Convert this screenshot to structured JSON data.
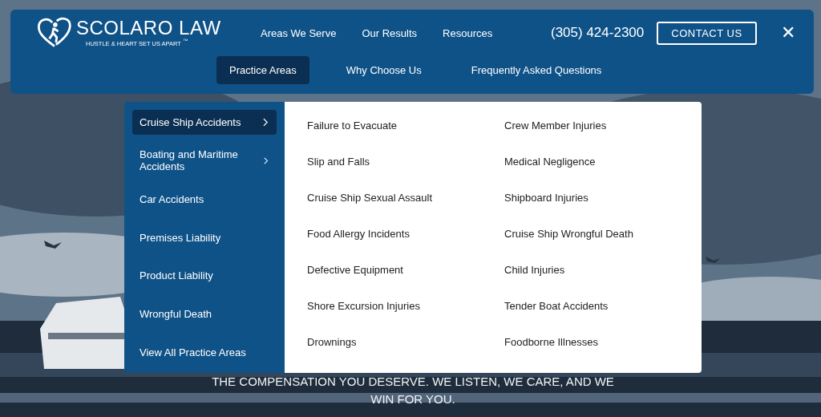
{
  "logo": {
    "name": "SCOLARO LAW",
    "tagline": "HUSTLE & HEART SET US APART $^{™}$"
  },
  "top_nav": [
    {
      "label": "Areas We Serve"
    },
    {
      "label": "Our Results"
    },
    {
      "label": "Resources"
    }
  ],
  "phone": "(305) 424-2300",
  "contact_button": "CONTACT US",
  "close_icon": "✕",
  "main_nav": [
    {
      "label": "Practice Areas",
      "selected": true
    },
    {
      "label": "Why Choose Us",
      "selected": false
    },
    {
      "label": "Frequently Asked Questions",
      "selected": false
    }
  ],
  "practice_categories": [
    {
      "label": "Cruise Ship Accidents",
      "selected": true,
      "has_submenu": true
    },
    {
      "label": "Boating and Maritime Accidents",
      "selected": false,
      "has_submenu": true
    },
    {
      "label": "Car Accidents",
      "selected": false,
      "has_submenu": false
    },
    {
      "label": "Premises Liability",
      "selected": false,
      "has_submenu": false
    },
    {
      "label": "Product Liability",
      "selected": false,
      "has_submenu": false
    },
    {
      "label": "Wrongful Death",
      "selected": false,
      "has_submenu": false
    },
    {
      "label": "View All Practice Areas",
      "selected": false,
      "has_submenu": false
    }
  ],
  "submenu_columns": [
    [
      "Failure to Evacuate",
      "Slip and Falls",
      "Cruise Ship Sexual Assault",
      "Food Allergy Incidents",
      "Defective Equipment",
      "Shore Excursion Injuries",
      "Drownings"
    ],
    [
      "Crew Member Injuries",
      "Medical Negligence",
      "Shipboard Injuries",
      "Cruise Ship Wrongful Death",
      "Child Injuries",
      "Tender Boat Accidents",
      "Foodborne Illnesses"
    ]
  ],
  "hero_text": [
    "THE COMPENSATION YOU DESERVE. WE LISTEN, WE CARE, AND WE",
    "WIN FOR YOU."
  ]
}
